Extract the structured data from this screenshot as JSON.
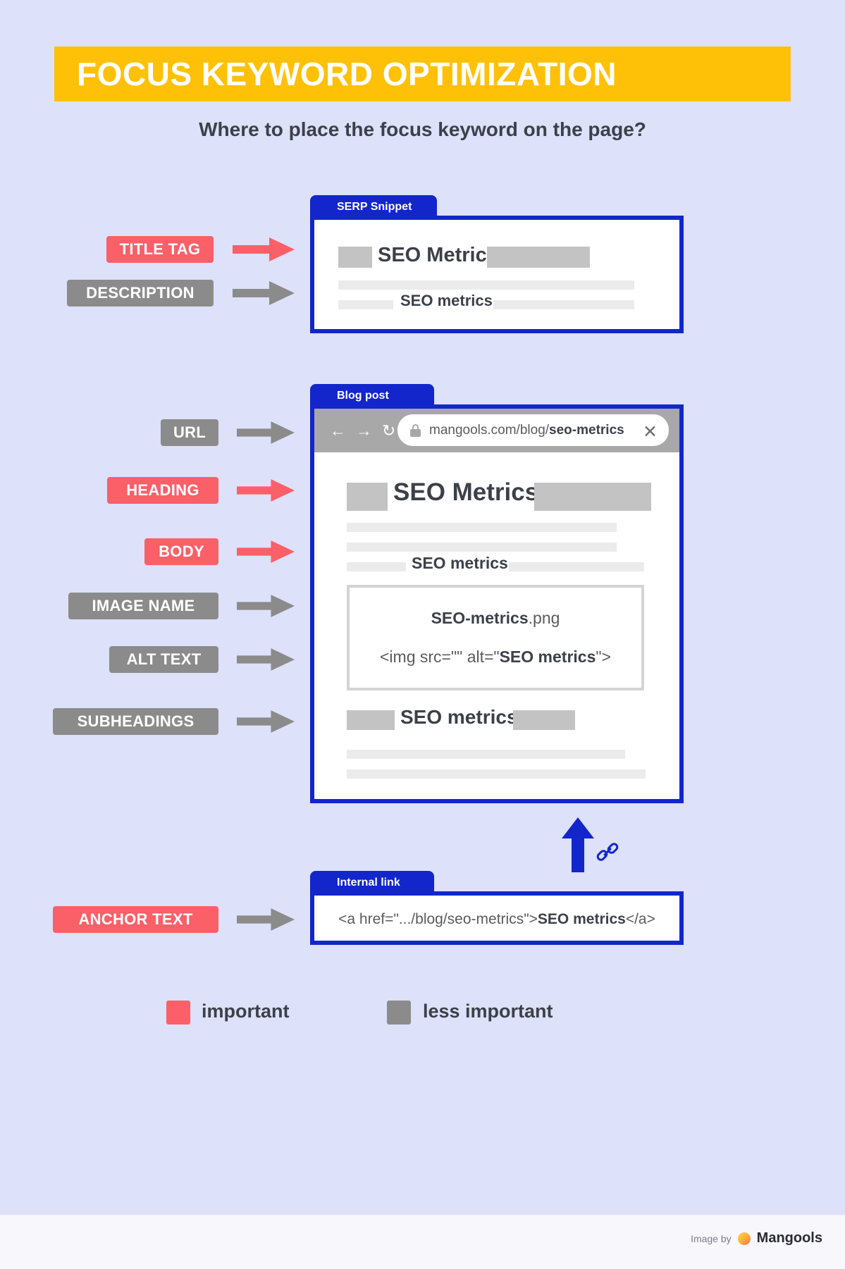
{
  "header": {
    "title": "FOCUS KEYWORD OPTIMIZATION",
    "subtitle": "Where to place the focus keyword on the page?",
    "banner_color": "#ffc107"
  },
  "colors": {
    "background": "#dde1fa",
    "important": "#fb5f68",
    "less_important": "#8b8b8b",
    "card_border": "#1226cc",
    "footer_background": "#f7f7fc"
  },
  "labels": {
    "title_tag": "TITLE TAG",
    "description": "DESCRIPTION",
    "url": "URL",
    "heading": "HEADING",
    "body": "BODY",
    "image_name": "IMAGE NAME",
    "alt_text": "ALT TEXT",
    "subheadings": "SUBHEADINGS",
    "anchor_text": "ANCHOR TEXT"
  },
  "serp_card": {
    "tab_label": "SERP Snippet",
    "title_keyword": "SEO Metrics",
    "description_keyword": "SEO metrics"
  },
  "blog_card": {
    "tab_label": "Blog post",
    "url_text_prefix": "mangools.com/blog/",
    "url_text_keyword": "seo-metrics",
    "nav_back_icon": "arrow-left-icon",
    "nav_forward_icon": "arrow-right-icon",
    "nav_reload_icon": "reload-icon",
    "lock_icon": "lock-icon",
    "close_icon": "close-icon",
    "heading_keyword": "SEO Metrics",
    "body_keyword": "SEO metrics",
    "image_name_keyword": "SEO-metrics",
    "image_name_extension": ".png",
    "alt_prefix": "<img src=\"\" alt=\"",
    "alt_keyword": "SEO metrics",
    "alt_suffix": "\">",
    "subheading_keyword": "SEO metrics"
  },
  "internal_link_card": {
    "tab_label": "Internal link",
    "code_prefix": "<a href=\".../blog/seo-metrics\">",
    "code_keyword": "SEO metrics",
    "code_suffix": "</a>",
    "uparrow_icon": "arrow-up-icon",
    "chain_icon": "link-chain-icon"
  },
  "legend": {
    "important": "important",
    "less_important": "less important"
  },
  "footer": {
    "image_by": "Image by",
    "brand": "Mangools",
    "brand_dot_icon": "mangools-logo-icon"
  }
}
